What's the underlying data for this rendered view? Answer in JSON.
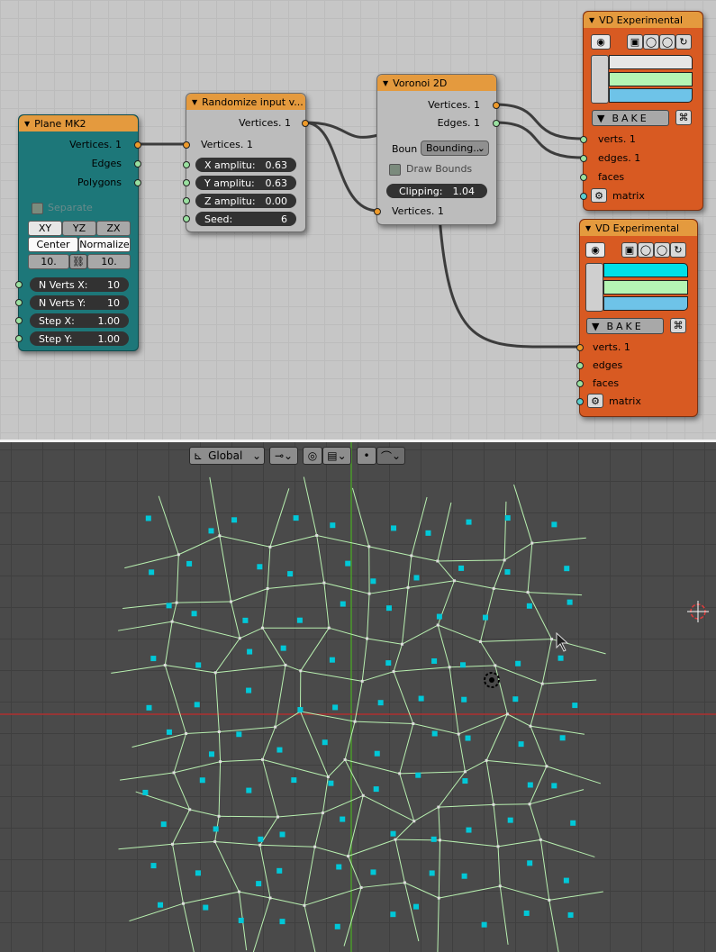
{
  "node_editor": {
    "plane": {
      "title": "Plane MK2",
      "outputs": [
        "Vertices. 1",
        "Edges",
        "Polygons"
      ],
      "separate_label": "Separate",
      "tabs": [
        "XY",
        "YZ",
        "ZX"
      ],
      "center_label": "Center",
      "normalize_label": "Normalize",
      "size_x": "10.",
      "size_y": "10.",
      "nverts_x_label": "N Verts X:",
      "nverts_x_value": "10",
      "nverts_y_label": "N Verts Y:",
      "nverts_y_value": "10",
      "step_x_label": "Step X:",
      "step_x_value": "1.00",
      "step_y_label": "Step Y:",
      "step_y_value": "1.00"
    },
    "randomize": {
      "title": "Randomize input v...",
      "output": "Vertices. 1",
      "input": "Vertices. 1",
      "x_label": "X amplitu:",
      "x_value": "0.63",
      "y_label": "Y amplitu:",
      "y_value": "0.63",
      "z_label": "Z amplitu:",
      "z_value": "0.00",
      "seed_label": "Seed:",
      "seed_value": "6"
    },
    "voronoi": {
      "title": "Voronoi 2D",
      "out_vertices": "Vertices. 1",
      "out_edges": "Edges. 1",
      "bound_label": "Boun",
      "bound_value": "Bounding...",
      "draw_bounds_label": "Draw Bounds",
      "clipping_label": "Clipping:",
      "clipping_value": "1.04",
      "in_vertices": "Vertices. 1"
    },
    "vd1": {
      "title": "VD Experimental",
      "bake_label": "BAKE",
      "inputs": [
        "verts. 1",
        "edges. 1",
        "faces",
        "matrix"
      ],
      "swatch_colors": [
        "#e6e6e6",
        "#b4f5b4",
        "#6ec3e8"
      ]
    },
    "vd2": {
      "title": "VD Experimental",
      "bake_label": "BAKE",
      "inputs": [
        "verts. 1",
        "edges",
        "faces",
        "matrix"
      ],
      "swatch_colors": [
        "#00e0e8",
        "#b4f5b4",
        "#6ec3e8"
      ]
    },
    "colors": {
      "link": "#3c3c3c",
      "socket_vertices": "#ee9a2a",
      "socket_generic": "#9ae0a0",
      "node_header": "#e49a3e",
      "plane_body": "#1d7779",
      "vd_body": "#d85a22"
    }
  },
  "viewport": {
    "orientation_label": "Global",
    "icons": [
      "transform-orientation-icon",
      "snap-icon",
      "proportional-icon",
      "pivot-icon"
    ],
    "colors": {
      "edges": "#b8f0b0",
      "points": "#00c8d8",
      "x_axis": "#b03030",
      "y_axis": "#4a9a2a"
    }
  }
}
